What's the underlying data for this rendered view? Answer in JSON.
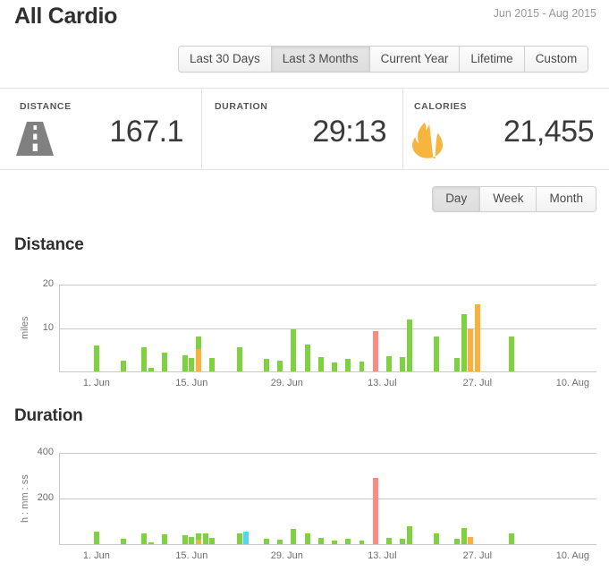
{
  "header": {
    "title": "All Cardio",
    "date_range": "Jun 2015 - Aug 2015"
  },
  "range_tabs": {
    "items": [
      {
        "label": "Last 30 Days",
        "active": false
      },
      {
        "label": "Last 3 Months",
        "active": true
      },
      {
        "label": "Current Year",
        "active": false
      },
      {
        "label": "Lifetime",
        "active": false
      },
      {
        "label": "Custom",
        "active": false
      }
    ]
  },
  "stats": [
    {
      "label": "DISTANCE",
      "value": "167.1",
      "icon": "road-icon"
    },
    {
      "label": "DURATION",
      "value": "29:13",
      "icon": null
    },
    {
      "label": "CALORIES",
      "value": "21,455",
      "icon": "flame-icon"
    }
  ],
  "granularity_tabs": {
    "items": [
      {
        "label": "Day",
        "active": true
      },
      {
        "label": "Week",
        "active": false
      },
      {
        "label": "Month",
        "active": false
      }
    ]
  },
  "colors": {
    "green": "#7ed13f",
    "orange": "#fbb03b",
    "red": "#fa8a82",
    "cyan": "#4fd8f0",
    "grid": "#c9c9c9",
    "tick_text": "#6e6e6e"
  },
  "chart_data": [
    {
      "id": "distance",
      "type": "bar",
      "title": "Distance",
      "xlabel": "",
      "ylabel": "miles",
      "ylim": [
        0,
        20
      ],
      "yticks": [
        10,
        20
      ],
      "grid": true,
      "stacked": true,
      "x_start": "2015-05-27",
      "x_end": "2015-08-13",
      "xtick_labels": [
        "1. Jun",
        "15. Jun",
        "29. Jun",
        "13. Jul",
        "27. Jul",
        "10. Aug"
      ],
      "xtick_days": [
        5,
        19,
        33,
        47,
        61,
        75
      ],
      "series": [
        {
          "name": "green",
          "color": "#7ed13f"
        },
        {
          "name": "orange",
          "color": "#fbb03b"
        },
        {
          "name": "red",
          "color": "#fa8a82"
        },
        {
          "name": "cyan",
          "color": "#4fd8f0"
        }
      ],
      "bars": [
        {
          "day": 5,
          "segments": [
            {
              "series": "green",
              "value": 5.9
            }
          ]
        },
        {
          "day": 9,
          "segments": [
            {
              "series": "green",
              "value": 2.5
            }
          ]
        },
        {
          "day": 12,
          "segments": [
            {
              "series": "green",
              "value": 5.5
            }
          ]
        },
        {
          "day": 13,
          "segments": [
            {
              "series": "green",
              "value": 0.9
            }
          ]
        },
        {
          "day": 15,
          "segments": [
            {
              "series": "green",
              "value": 4.4
            }
          ]
        },
        {
          "day": 18,
          "segments": [
            {
              "series": "green",
              "value": 3.8
            }
          ]
        },
        {
          "day": 19,
          "segments": [
            {
              "series": "green",
              "value": 3.0
            }
          ]
        },
        {
          "day": 20,
          "segments": [
            {
              "series": "orange",
              "value": 5.2
            },
            {
              "series": "green",
              "value": 2.9
            }
          ]
        },
        {
          "day": 22,
          "segments": [
            {
              "series": "green",
              "value": 3.0
            }
          ]
        },
        {
          "day": 26,
          "segments": [
            {
              "series": "green",
              "value": 5.5
            }
          ]
        },
        {
          "day": 30,
          "segments": [
            {
              "series": "green",
              "value": 2.9
            }
          ]
        },
        {
          "day": 32,
          "segments": [
            {
              "series": "green",
              "value": 2.5
            }
          ]
        },
        {
          "day": 34,
          "segments": [
            {
              "series": "green",
              "value": 9.6
            }
          ]
        },
        {
          "day": 36,
          "segments": [
            {
              "series": "green",
              "value": 6.1
            }
          ]
        },
        {
          "day": 38,
          "segments": [
            {
              "series": "green",
              "value": 3.4
            }
          ]
        },
        {
          "day": 40,
          "segments": [
            {
              "series": "green",
              "value": 2.1
            }
          ]
        },
        {
          "day": 42,
          "segments": [
            {
              "series": "green",
              "value": 2.9
            }
          ]
        },
        {
          "day": 44,
          "segments": [
            {
              "series": "green",
              "value": 2.2
            }
          ]
        },
        {
          "day": 46,
          "segments": [
            {
              "series": "red",
              "value": 9.2
            }
          ]
        },
        {
          "day": 48,
          "segments": [
            {
              "series": "green",
              "value": 3.5
            }
          ]
        },
        {
          "day": 50,
          "segments": [
            {
              "series": "green",
              "value": 3.3
            }
          ]
        },
        {
          "day": 51,
          "segments": [
            {
              "series": "green",
              "value": 12.0
            }
          ]
        },
        {
          "day": 55,
          "segments": [
            {
              "series": "green",
              "value": 8.0
            }
          ]
        },
        {
          "day": 58,
          "segments": [
            {
              "series": "green",
              "value": 3.0
            }
          ]
        },
        {
          "day": 59,
          "segments": [
            {
              "series": "green",
              "value": 13.3
            }
          ]
        },
        {
          "day": 60,
          "segments": [
            {
              "series": "orange",
              "value": 10.0
            }
          ]
        },
        {
          "day": 61,
          "segments": [
            {
              "series": "orange",
              "value": 15.5
            }
          ]
        },
        {
          "day": 66,
          "segments": [
            {
              "series": "green",
              "value": 8.0
            }
          ]
        }
      ]
    },
    {
      "id": "duration",
      "type": "bar",
      "title": "Duration",
      "xlabel": "",
      "ylabel": "h : mm : ss",
      "ylim": [
        0,
        400
      ],
      "yticks": [
        200,
        400
      ],
      "grid": true,
      "stacked": true,
      "x_start": "2015-05-27",
      "x_end": "2015-08-13",
      "xtick_labels": [
        "1. Jun",
        "15. Jun",
        "29. Jun",
        "13. Jul",
        "27. Jul",
        "10. Aug"
      ],
      "xtick_days": [
        5,
        19,
        33,
        47,
        61,
        75
      ],
      "series": [
        {
          "name": "green",
          "color": "#7ed13f"
        },
        {
          "name": "orange",
          "color": "#fbb03b"
        },
        {
          "name": "red",
          "color": "#fa8a82"
        },
        {
          "name": "cyan",
          "color": "#4fd8f0"
        }
      ],
      "bars": [
        {
          "day": 5,
          "segments": [
            {
              "series": "green",
              "value": 56
            }
          ]
        },
        {
          "day": 9,
          "segments": [
            {
              "series": "green",
              "value": 25
            }
          ]
        },
        {
          "day": 12,
          "segments": [
            {
              "series": "green",
              "value": 48
            }
          ]
        },
        {
          "day": 13,
          "segments": [
            {
              "series": "green",
              "value": 8
            }
          ]
        },
        {
          "day": 15,
          "segments": [
            {
              "series": "green",
              "value": 42
            }
          ]
        },
        {
          "day": 18,
          "segments": [
            {
              "series": "green",
              "value": 38
            }
          ]
        },
        {
          "day": 19,
          "segments": [
            {
              "series": "green",
              "value": 30
            }
          ]
        },
        {
          "day": 20,
          "segments": [
            {
              "series": "orange",
              "value": 18
            },
            {
              "series": "green",
              "value": 30
            }
          ]
        },
        {
          "day": 21,
          "segments": [
            {
              "series": "green",
              "value": 48
            }
          ]
        },
        {
          "day": 22,
          "segments": [
            {
              "series": "green",
              "value": 28
            }
          ]
        },
        {
          "day": 26,
          "segments": [
            {
              "series": "green",
              "value": 46
            }
          ]
        },
        {
          "day": 27,
          "segments": [
            {
              "series": "cyan",
              "value": 56
            }
          ]
        },
        {
          "day": 30,
          "segments": [
            {
              "series": "green",
              "value": 24
            }
          ]
        },
        {
          "day": 32,
          "segments": [
            {
              "series": "green",
              "value": 20
            }
          ]
        },
        {
          "day": 34,
          "segments": [
            {
              "series": "green",
              "value": 65
            }
          ]
        },
        {
          "day": 36,
          "segments": [
            {
              "series": "green",
              "value": 46
            }
          ]
        },
        {
          "day": 38,
          "segments": [
            {
              "series": "green",
              "value": 28
            }
          ]
        },
        {
          "day": 40,
          "segments": [
            {
              "series": "green",
              "value": 17
            }
          ]
        },
        {
          "day": 42,
          "segments": [
            {
              "series": "green",
              "value": 22
            }
          ]
        },
        {
          "day": 44,
          "segments": [
            {
              "series": "green",
              "value": 16
            }
          ]
        },
        {
          "day": 46,
          "segments": [
            {
              "series": "red",
              "value": 290
            }
          ]
        },
        {
          "day": 48,
          "segments": [
            {
              "series": "green",
              "value": 28
            }
          ]
        },
        {
          "day": 50,
          "segments": [
            {
              "series": "green",
              "value": 22
            }
          ]
        },
        {
          "day": 51,
          "segments": [
            {
              "series": "green",
              "value": 80
            }
          ]
        },
        {
          "day": 55,
          "segments": [
            {
              "series": "green",
              "value": 48
            }
          ]
        },
        {
          "day": 58,
          "segments": [
            {
              "series": "green",
              "value": 24
            }
          ]
        },
        {
          "day": 59,
          "segments": [
            {
              "series": "green",
              "value": 70
            }
          ]
        },
        {
          "day": 60,
          "segments": [
            {
              "series": "orange",
              "value": 32
            }
          ]
        },
        {
          "day": 66,
          "segments": [
            {
              "series": "green",
              "value": 46
            }
          ]
        }
      ]
    }
  ]
}
